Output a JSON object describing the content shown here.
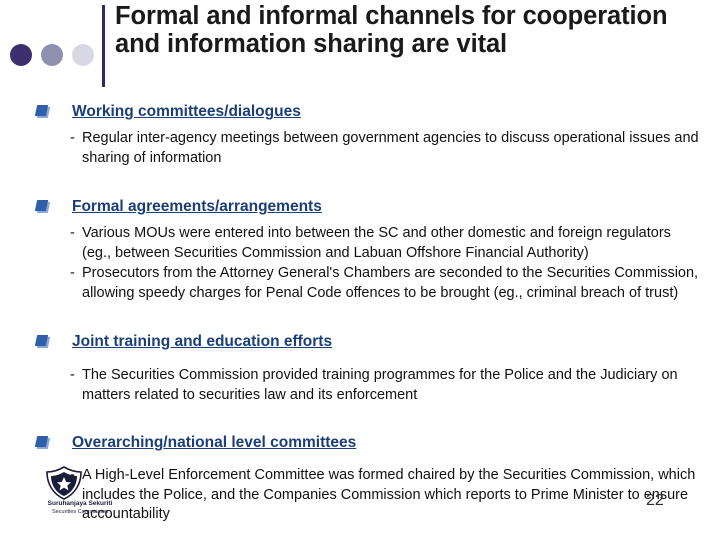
{
  "slide": {
    "title": "Formal and informal channels for cooperation and information sharing are vital",
    "page_number": "22",
    "decor": {
      "circle_colors": [
        "#3b2f6e",
        "#8f8fb0",
        "#d8d8e4"
      ],
      "title_rule_color": "#2b2b6b"
    },
    "bullets": [
      {
        "heading": "Working committees/dialogues",
        "items": [
          "Regular inter-agency meetings between government agencies to discuss operational issues and sharing of information"
        ]
      },
      {
        "heading": "Formal agreements/arrangements",
        "items": [
          "Various MOUs were entered into between the SC and other domestic and foreign regulators (eg., between Securities Commission and Labuan Offshore Financial Authority)",
          "Prosecutors from the Attorney General's Chambers are seconded to the Securities Commission, allowing speedy charges for Penal Code offences to be brought (eg., criminal breach of trust)"
        ]
      },
      {
        "heading": "Joint training and education efforts",
        "items": [
          "The Securities Commission provided training programmes for the Police and the Judiciary on matters related to securities law and its enforcement"
        ]
      },
      {
        "heading": "Overarching/national level committees",
        "items": [
          "A High-Level Enforcement Committee was formed chaired by the Securities Commission, which includes the Police, and the Companies Commission which reports to Prime Minister to ensure accountability"
        ]
      }
    ],
    "dash": "-"
  },
  "logo": {
    "line1": "Suruhanjaya Sekuriti",
    "line2": "Securities Commission"
  }
}
